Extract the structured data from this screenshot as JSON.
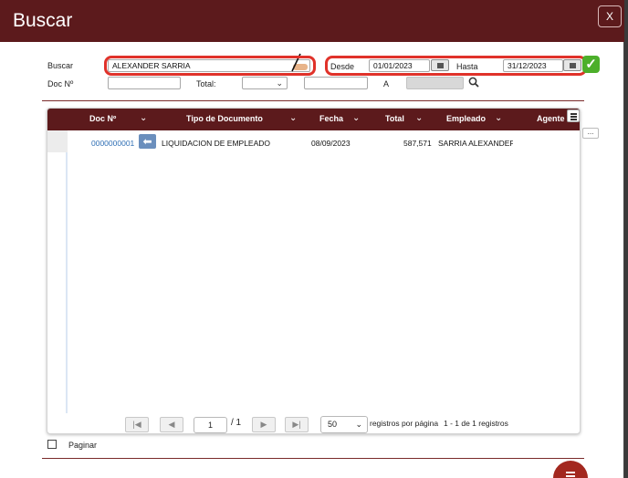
{
  "dialog": {
    "title": "Buscar",
    "close_label": "X"
  },
  "form": {
    "buscar_label": "Buscar",
    "buscar_value": "ALEXANDER SARRIA",
    "desde_label": "Desde",
    "desde_value": "01/01/2023",
    "hasta_label": "Hasta",
    "hasta_value": "31/12/2023",
    "docno_label": "Doc Nº",
    "docno_value": "",
    "total_label": "Total:",
    "total_operator": "",
    "total_value": "",
    "a_label": "A",
    "a_value": ""
  },
  "grid": {
    "columns": [
      "Doc Nº",
      "Tipo de Documento",
      "Fecha",
      "Total",
      "Empleado",
      "Agente"
    ],
    "rows": [
      {
        "doc": "0000000001",
        "tipo": "LIQUIDACION DE EMPLEADO",
        "fecha": "08/09/2023",
        "total": "587,571",
        "empleado": "SARRIA  ALEXANDEF"
      }
    ],
    "more_label": "..."
  },
  "pager": {
    "page": "1",
    "total_pages": "/ 1",
    "page_size": "50",
    "per_page_label": "registros por página",
    "range_label": "1 - 1 de 1 registros",
    "first": "|◀",
    "prev": "◀",
    "next": "▶",
    "last": "▶|"
  },
  "footer": {
    "paginar_label": "Paginar"
  },
  "colors": {
    "brand": "#5c1a1c",
    "highlight": "#e0322a",
    "confirm": "#4caf2a",
    "link": "#2f6fb5"
  },
  "icons": [
    "close-icon",
    "calendar-icon",
    "check-icon",
    "search-icon",
    "menu-icon",
    "back-arrow-icon",
    "chevron-down-icon",
    "pencil-icon"
  ]
}
